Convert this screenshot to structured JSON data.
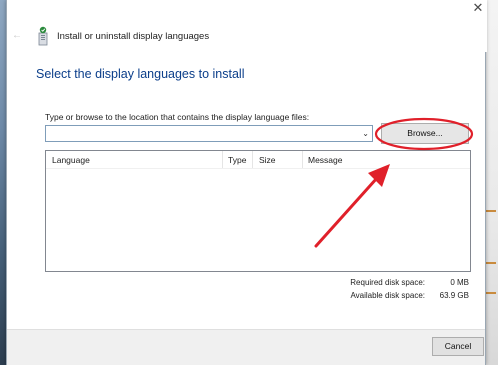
{
  "window": {
    "title": "Install or uninstall display languages",
    "heading": "Select the display languages to install"
  },
  "location": {
    "prompt": "Type or browse to the location that contains the display language files:",
    "value": "",
    "browse_label": "Browse..."
  },
  "list": {
    "columns": [
      "Language",
      "Type",
      "Size",
      "Message"
    ],
    "rows": []
  },
  "disk": {
    "required_label": "Required disk space:",
    "required_value": "0 MB",
    "available_label": "Available disk space:",
    "available_value": "63.9 GB"
  },
  "footer": {
    "cancel_label": "Cancel"
  },
  "icons": {
    "back": "back-arrow-icon",
    "app": "language-pack-icon",
    "close": "close-icon",
    "dropdown": "chevron-down-icon"
  },
  "colors": {
    "heading": "#0b3e8a",
    "annotation": "#e0202a"
  }
}
